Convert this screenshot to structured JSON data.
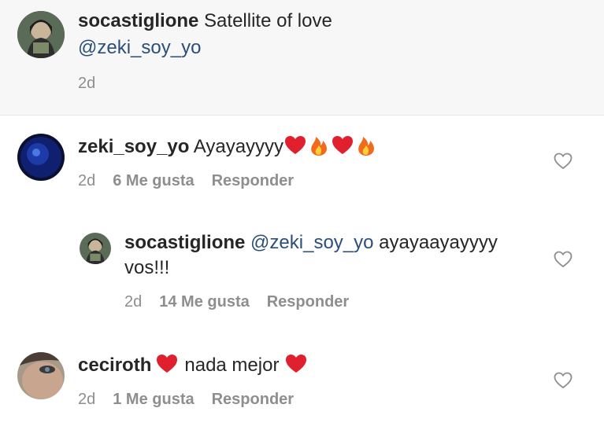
{
  "caption": {
    "username": "socastiglione",
    "text": "Satellite of love",
    "mention": "@zeki_soy_yo",
    "time": "2d"
  },
  "comments": [
    {
      "username": "zeki_soy_yo",
      "text": "Ayayayyyy",
      "emojis": [
        "heart",
        "fire",
        "heart",
        "fire"
      ],
      "time": "2d",
      "likes": "6 Me gusta",
      "reply": "Responder"
    },
    {
      "username": "socastiglione",
      "mention": "@zeki_soy_yo",
      "text": "ayayaayayyyy",
      "text_cont": "vos!!!",
      "time": "2d",
      "likes": "14 Me gusta",
      "reply": "Responder"
    },
    {
      "username": "ceciroth",
      "text": "nada mejor",
      "emojis": [
        "heart",
        "heart"
      ],
      "time": "2d",
      "likes": "1 Me gusta",
      "reply": "Responder"
    }
  ],
  "colors": {
    "text": "#262626",
    "mention": "#2b4f7a",
    "meta": "#8e8e8e",
    "caption_bg": "#f7f7f7",
    "heart_emoji": "#e0202e",
    "fire_emoji": "#f26b1d"
  }
}
